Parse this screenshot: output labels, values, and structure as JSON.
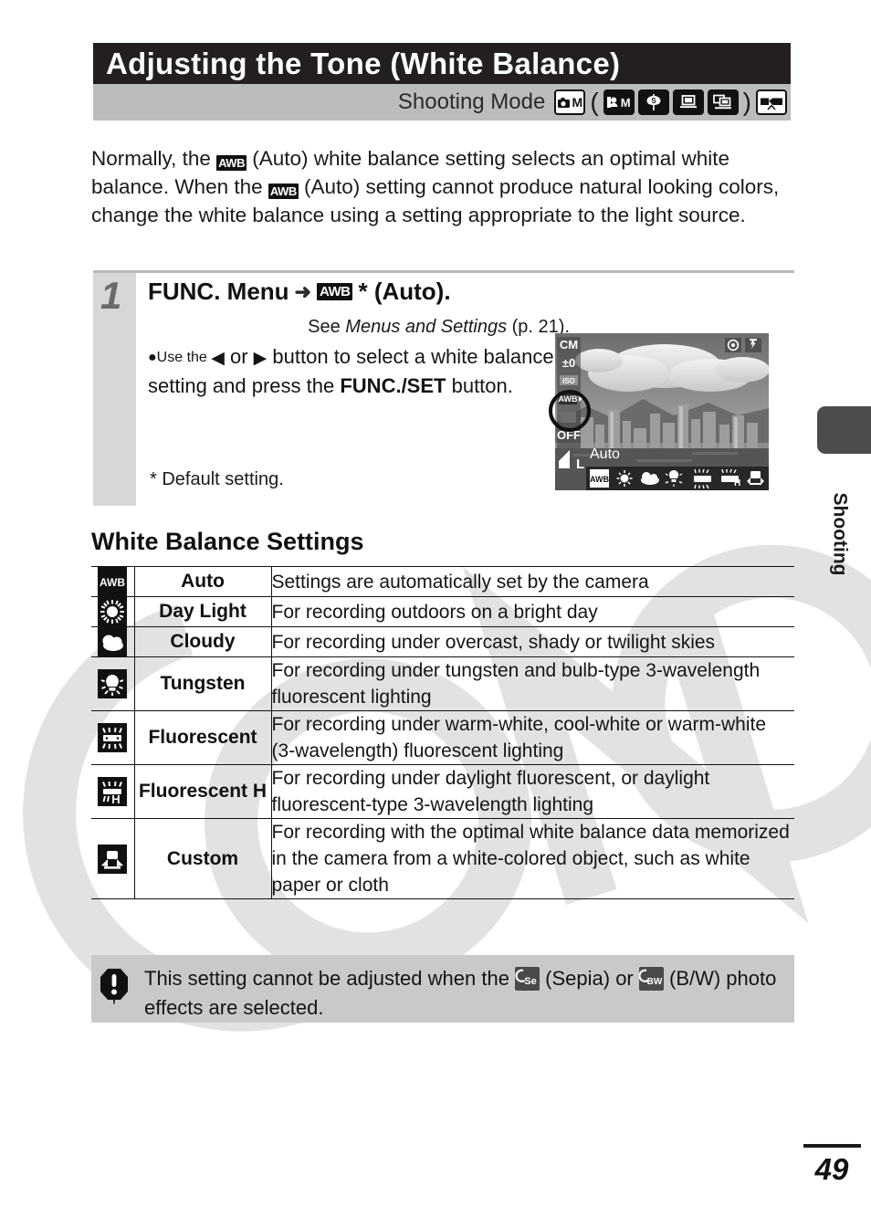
{
  "header": {
    "title": "Adjusting the Tone (White Balance)",
    "mode_label": "Shooting Mode",
    "mode_icons": [
      {
        "name": "camera-m-icon",
        "glyph": "M"
      },
      {
        "name": "paren-open",
        "glyph": "("
      },
      {
        "name": "portrait-m-icon",
        "glyph": "M"
      },
      {
        "name": "foliage-icon",
        "glyph": "S"
      },
      {
        "name": "indoor-icon",
        "glyph": ""
      },
      {
        "name": "kids-pets-icon",
        "glyph": ""
      },
      {
        "name": "paren-close",
        "glyph": ")"
      },
      {
        "name": "movie-icon",
        "glyph": ""
      }
    ]
  },
  "intro": {
    "part1": "Normally, the ",
    "awb1": "AWB",
    "part2": " (Auto) white balance setting selects an optimal white balance. When the ",
    "awb2": "AWB",
    "part3": " (Auto) setting cannot produce natural looking colors, change the white balance using a setting appropriate to the light source."
  },
  "step": {
    "number": "1",
    "heading_before": "FUNC. Menu",
    "heading_arrow": "➜",
    "heading_awb": "AWB",
    "heading_after": "* (Auto).",
    "see_prefix": "See ",
    "see_italic": "Menus and Settings",
    "see_suffix": " (p. 21).",
    "bullet": "●Use the ◀ or ▶ button to select a white balance setting and press the FUNC./SET button.",
    "bullet_pre": "●Use the ",
    "bullet_left": "◀",
    "bullet_mid": " or ",
    "bullet_right": "▶",
    "bullet_post": " button to select a white balance setting and press the ",
    "bullet_bold": "FUNC./SET",
    "bullet_end": " button.",
    "default_note": "*  Default setting."
  },
  "lcd": {
    "mode_indicator": "CM",
    "exposure": "±0",
    "iso": "ISO",
    "wb": "AWB",
    "flash": "OFF",
    "quality": "L",
    "caption": "Auto",
    "redeye_icon": "red-eye-icon",
    "flash-on_icon": "flash-icon",
    "menu_items": [
      "AWB",
      "daylight",
      "cloudy",
      "tungsten",
      "fluorescent",
      "fluorescent-h",
      "custom"
    ]
  },
  "settings_section": {
    "heading": "White Balance Settings",
    "rows": [
      {
        "icon": "awb-icon",
        "name": "Auto",
        "desc": "Settings are automatically set by the camera"
      },
      {
        "icon": "daylight-icon",
        "name": "Day Light",
        "desc": "For recording outdoors on a bright day"
      },
      {
        "icon": "cloudy-icon",
        "name": "Cloudy",
        "desc": "For recording under overcast, shady or twilight skies"
      },
      {
        "icon": "tungsten-icon",
        "name": "Tungsten",
        "desc": "For recording under tungsten and bulb-type 3-wavelength fluorescent lighting"
      },
      {
        "icon": "fluorescent-icon",
        "name": "Fluorescent",
        "desc": "For recording under warm-white, cool-white or warm-white (3-wavelength) fluorescent lighting"
      },
      {
        "icon": "fluorescent-h-icon",
        "name": "Fluorescent H",
        "desc": "For recording under daylight fluorescent, or daylight fluorescent-type 3-wavelength lighting"
      },
      {
        "icon": "custom-icon",
        "name": "Custom",
        "desc": "For recording with the optimal white balance data memorized in the camera from a white-colored object, such as white paper or cloth"
      }
    ]
  },
  "note": {
    "icon": "warning-icon",
    "text_1": "This setting cannot be adjusted when the ",
    "sepia_icon_label": "Se",
    "text_2": " (Sepia) or ",
    "bw_icon_label": "BW",
    "text_3": " (B/W) photo effects are selected."
  },
  "side_tab": {
    "label": "Shooting"
  },
  "footer": {
    "page_number": "49"
  },
  "colors": {
    "header_bg": "#231f20",
    "mode_bar_bg": "#bcbcbc",
    "step_col_bg": "#d7d7d7",
    "note_bg": "#c9c9c9",
    "tab_bg": "#4d4d4d",
    "ink": "#111111"
  }
}
